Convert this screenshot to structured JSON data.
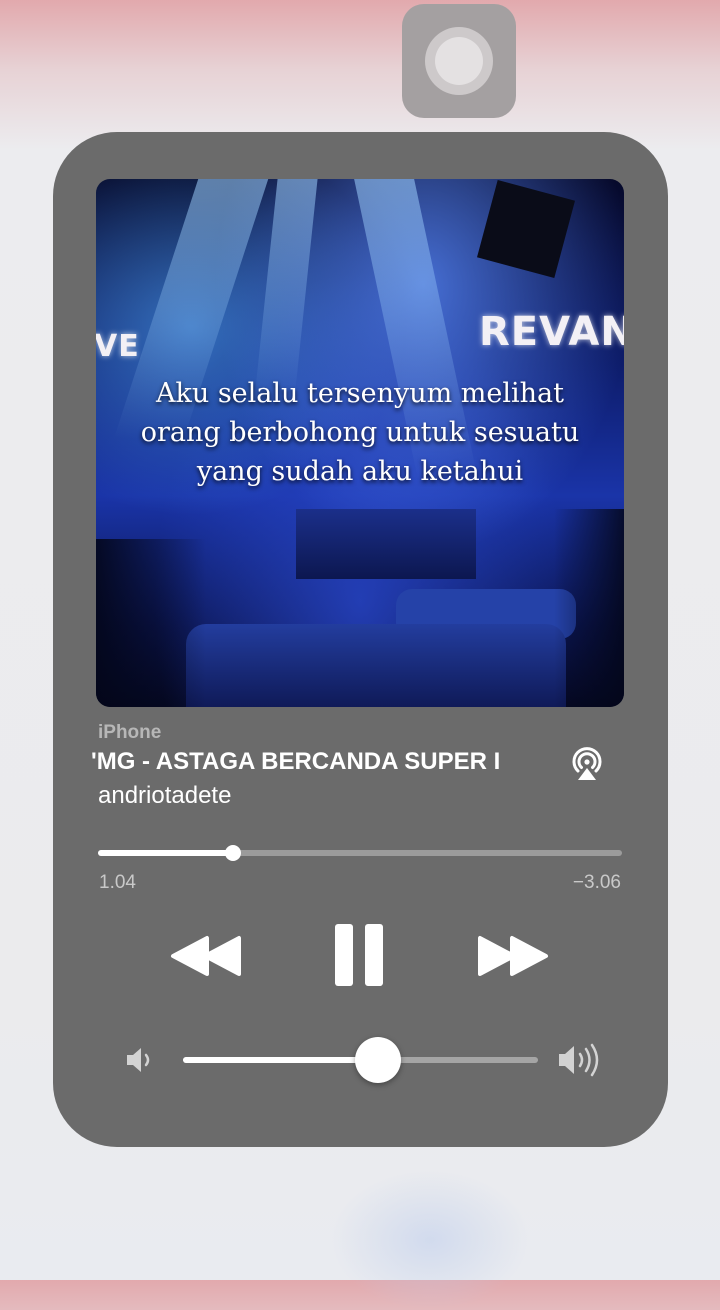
{
  "now_playing": {
    "device": "iPhone",
    "title": "'MG - ASTAGA BERCANDA SUPER I",
    "artist": "andriotadete",
    "artwork": {
      "signs": {
        "right": "REVAN",
        "left": "VE"
      },
      "lyric_lines": [
        "Aku selalu tersenyum melihat",
        "orang berbohong untuk sesuatu",
        "yang sudah aku ketahui"
      ]
    },
    "progress": {
      "elapsed": "1.04",
      "remaining": "−3.06",
      "fraction": 0.257
    },
    "volume": {
      "fraction": 0.55
    }
  },
  "icons": {
    "airplay": "airplay-audio-icon",
    "rewind": "rewind-icon",
    "pause": "pause-icon",
    "forward": "fast-forward-icon",
    "volume_low": "speaker-low-icon",
    "volume_high": "speaker-high-icon"
  },
  "colors": {
    "panel": "#6b6b6b",
    "accent": "#ffffff",
    "secondary_text": "#c9c9c9"
  }
}
